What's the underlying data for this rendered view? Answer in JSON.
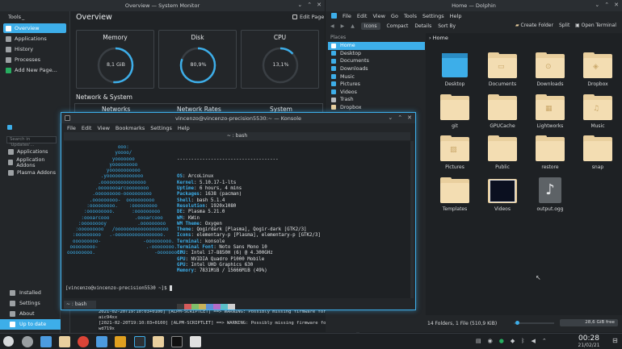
{
  "sysmon": {
    "title": "Overview — System Monitor",
    "tools_label": "Tools",
    "side_items": [
      {
        "label": "Overview",
        "active": true
      },
      {
        "label": "Applications",
        "active": false
      },
      {
        "label": "History",
        "active": false
      },
      {
        "label": "Processes",
        "active": false
      },
      {
        "label": "Add New Page...",
        "active": false
      }
    ],
    "page_title": "Overview",
    "edit_label": "Edit Page",
    "cards": [
      {
        "title": "Memory",
        "value": "8,1 GiB",
        "fraction": 0.52
      },
      {
        "title": "Disk",
        "value": "80,9%",
        "fraction": 0.809
      },
      {
        "title": "CPU",
        "value": "13,1%",
        "fraction": 0.131
      }
    ],
    "section": "Network & System",
    "col_heads": [
      "Networks",
      "Network Rates",
      "System"
    ]
  },
  "updates": {
    "search_placeholder": "Search in 'Updates'...",
    "items": [
      "Applications",
      "Application Addons",
      "Plasma Addons"
    ],
    "bottom_items": [
      "Installed",
      "Settings",
      "About",
      "Up to date"
    ]
  },
  "dolphin": {
    "title": "Home — Dolphin",
    "menu": [
      "File",
      "Edit",
      "View",
      "Go",
      "Tools",
      "Settings",
      "Help"
    ],
    "toolbar": {
      "icons": "Icons",
      "compact": "Compact",
      "details": "Details",
      "sort": "Sort By",
      "create": "Create Folder",
      "split": "Split",
      "terminal": "Open Terminal"
    },
    "places_header": "Places",
    "places": [
      {
        "label": "Home",
        "active": true
      },
      {
        "label": "Desktop",
        "active": false
      },
      {
        "label": "Documents",
        "active": false
      },
      {
        "label": "Downloads",
        "active": false
      },
      {
        "label": "Music",
        "active": false
      },
      {
        "label": "Pictures",
        "active": false
      },
      {
        "label": "Videos",
        "active": false
      },
      {
        "label": "Trash",
        "active": false
      },
      {
        "label": "Dropbox",
        "active": false
      }
    ],
    "breadcrumb": "Home",
    "items": [
      {
        "label": "Desktop",
        "kind": "desktop"
      },
      {
        "label": "Documents",
        "kind": "doc"
      },
      {
        "label": "Downloads",
        "kind": "down"
      },
      {
        "label": "Dropbox",
        "kind": "box"
      },
      {
        "label": "git",
        "kind": "plain"
      },
      {
        "label": "GPUCache",
        "kind": "plain"
      },
      {
        "label": "Lightworks",
        "kind": "lw"
      },
      {
        "label": "Music",
        "kind": "music"
      },
      {
        "label": "Pictures",
        "kind": "pic"
      },
      {
        "label": "Public",
        "kind": "plain"
      },
      {
        "label": "restore",
        "kind": "plain"
      },
      {
        "label": "snap",
        "kind": "plain"
      },
      {
        "label": "Templates",
        "kind": "plain"
      },
      {
        "label": "Videos",
        "kind": "video"
      },
      {
        "label": "output.ogg",
        "kind": "audio"
      }
    ],
    "status": "14 Folders, 1 File (510,9 KiB)",
    "free": "28,6 GiB free"
  },
  "konsole": {
    "title": "vincenzo@vincenzo-precision5530:~ — Konsole",
    "menu": [
      "File",
      "Edit",
      "View",
      "Bookmarks",
      "Settings",
      "Help"
    ],
    "tab_title": "~ : bash",
    "ascii": "                  ooo:\n                 yoooo/\n                yooooooo\n               yooooooooo\n              yooooooooooo\n            .yooooooooooooo\n           .oooooooooooooooo\n          .oooooooarcoooooooo\n         .ooooooooo-oooooooooo\n        .ooooooooo-  oooooooooo\n       :ooooooooo.    :ooooooooo\n      :ooooooooo.      :ooooooooo\n     :oooarcooo         .oooarcooo\n    :ooooooooy           .ooooooooo\n   :ooooooooo   /ooooooooooooooooooo\n  :ooooooooo   .-ooooooooooooooooo.\n  ooooooooo-               -ooooooooo.\n ooooooooo-                 .-oooooooo.\nooooooooo.                     -ooooooooo",
    "rule": "------------------------------------",
    "info": [
      {
        "k": "OS",
        "v": "ArcoLinux"
      },
      {
        "k": "Kernel",
        "v": "5.10.17-1-lts"
      },
      {
        "k": "Uptime",
        "v": "6 hours, 4 mins"
      },
      {
        "k": "Packages",
        "v": "1638 (pacman)"
      },
      {
        "k": "Shell",
        "v": "bash 5.1.4"
      },
      {
        "k": "Resolution",
        "v": "1920x1080"
      },
      {
        "k": "DE",
        "v": "Plasma 5.21.0"
      },
      {
        "k": "WM",
        "v": "KWin"
      },
      {
        "k": "WM Theme",
        "v": "Oxygen"
      },
      {
        "k": "Theme",
        "v": "Qogirdark [Plasma], Qogir-dark [GTK2/3]"
      },
      {
        "k": "Icons",
        "v": "elementary-p [Plasma], elementary-p [GTK2/3]"
      },
      {
        "k": "Terminal",
        "v": "konsole"
      },
      {
        "k": "Terminal Font",
        "v": "Noto Sans Mono 10"
      },
      {
        "k": "CPU",
        "v": "Intel i7-8850H (6) @ 4.300GHz"
      },
      {
        "k": "GPU",
        "v": "NVIDIA Quadro P1000 Mobile"
      },
      {
        "k": "GPU",
        "v": "Intel UHD Graphics 630"
      },
      {
        "k": "Memory",
        "v": "7831MiB / 15666MiB (49%)"
      }
    ],
    "swatches_top": [
      "#3b3b3b",
      "#d55b5b",
      "#7fbf6a",
      "#c8b25a",
      "#5b8fd5",
      "#b56cc8",
      "#5bbfc8",
      "#cfcfcf"
    ],
    "swatches_bottom": [
      "#5b5b5b",
      "#e28a8a",
      "#a9d79a",
      "#e4d28a",
      "#8ab3e4",
      "#d39ae0",
      "#8ad9e0",
      "#f2f2f2"
    ],
    "prompt": "[vincenzo@vincenzo-precision5530 ~]$",
    "bottom_tab": "~ : bash"
  },
  "log_lines": [
    "2021-02-20T19:10:03+0100] [ALPM-SCRIPTLET] ==> WARNING: Possibly missing firmware for module:",
    "aic94xx",
    "[2021-02-20T19:10:03+0100] [ALPM-SCRIPTLET] ==> WARNING: Possibly missing firmware for module:",
    "wd719x"
  ],
  "taskbar": {
    "time": "00:28",
    "date": "21/02/21"
  },
  "colors": {
    "accent": "#3daee9",
    "bg": "#232629",
    "folder": "#f3ddb2"
  }
}
